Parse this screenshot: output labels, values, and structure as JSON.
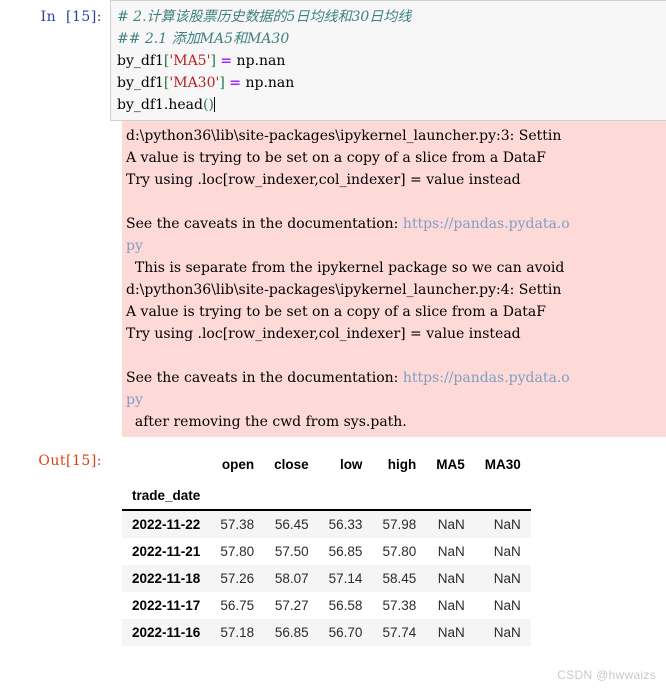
{
  "input_cell": {
    "prompt": "In  [15]:",
    "code_lines": [
      {
        "type": "comment",
        "text": "# 2.计算该股票历史数据的5日均线和30日均线"
      },
      {
        "type": "comment",
        "text": "## 2.1 添加MA5和MA30"
      },
      {
        "type": "assign",
        "target": "by_df1",
        "bracket_open": "[",
        "string": "'MA5'",
        "bracket_close": "]",
        "operator": "=",
        "value": " np.nan"
      },
      {
        "type": "assign",
        "target": "by_df1",
        "bracket_open": "[",
        "string": "'MA30'",
        "bracket_close": "]",
        "operator": "=",
        "value": " np.nan"
      },
      {
        "type": "call",
        "target": "by_df1.head",
        "paren": "()"
      }
    ]
  },
  "warning_output": {
    "lines": [
      {
        "text": "d:\\python36\\lib\\site-packages\\ipykernel_launcher.py:3: Settin",
        "link": ""
      },
      {
        "text": "A value is trying to be set on a copy of a slice from a DataF",
        "link": ""
      },
      {
        "text": "Try using .loc[row_indexer,col_indexer] = value instead",
        "link": ""
      },
      {
        "text": "",
        "link": ""
      },
      {
        "text": "See the caveats in the documentation: ",
        "link": "https://pandas.pydata.o"
      },
      {
        "text": "",
        "link": "py"
      },
      {
        "text": "  This is separate from the ipykernel package so we can avoid",
        "link": ""
      },
      {
        "text": "d:\\python36\\lib\\site-packages\\ipykernel_launcher.py:4: Settin",
        "link": ""
      },
      {
        "text": "A value is trying to be set on a copy of a slice from a DataF",
        "link": ""
      },
      {
        "text": "Try using .loc[row_indexer,col_indexer] = value instead",
        "link": ""
      },
      {
        "text": "",
        "link": ""
      },
      {
        "text": "See the caveats in the documentation: ",
        "link": "https://pandas.pydata.o"
      },
      {
        "text": "",
        "link": "py"
      },
      {
        "text": "  after removing the cwd from sys.path.",
        "link": ""
      }
    ]
  },
  "output_cell": {
    "prompt": "Out[15]:",
    "table": {
      "columns": [
        "open",
        "close",
        "low",
        "high",
        "MA5",
        "MA30"
      ],
      "index_name": "trade_date",
      "rows": [
        {
          "index": "2022-11-22",
          "values": [
            "57.38",
            "56.45",
            "56.33",
            "57.98",
            "NaN",
            "NaN"
          ]
        },
        {
          "index": "2022-11-21",
          "values": [
            "57.80",
            "57.50",
            "56.85",
            "57.80",
            "NaN",
            "NaN"
          ]
        },
        {
          "index": "2022-11-18",
          "values": [
            "57.26",
            "58.07",
            "57.14",
            "58.45",
            "NaN",
            "NaN"
          ]
        },
        {
          "index": "2022-11-17",
          "values": [
            "56.75",
            "57.27",
            "56.58",
            "57.38",
            "NaN",
            "NaN"
          ]
        },
        {
          "index": "2022-11-16",
          "values": [
            "57.18",
            "56.85",
            "56.70",
            "57.74",
            "NaN",
            "NaN"
          ]
        }
      ]
    }
  },
  "watermark": {
    "text": "CSDN @hwwaizs"
  }
}
